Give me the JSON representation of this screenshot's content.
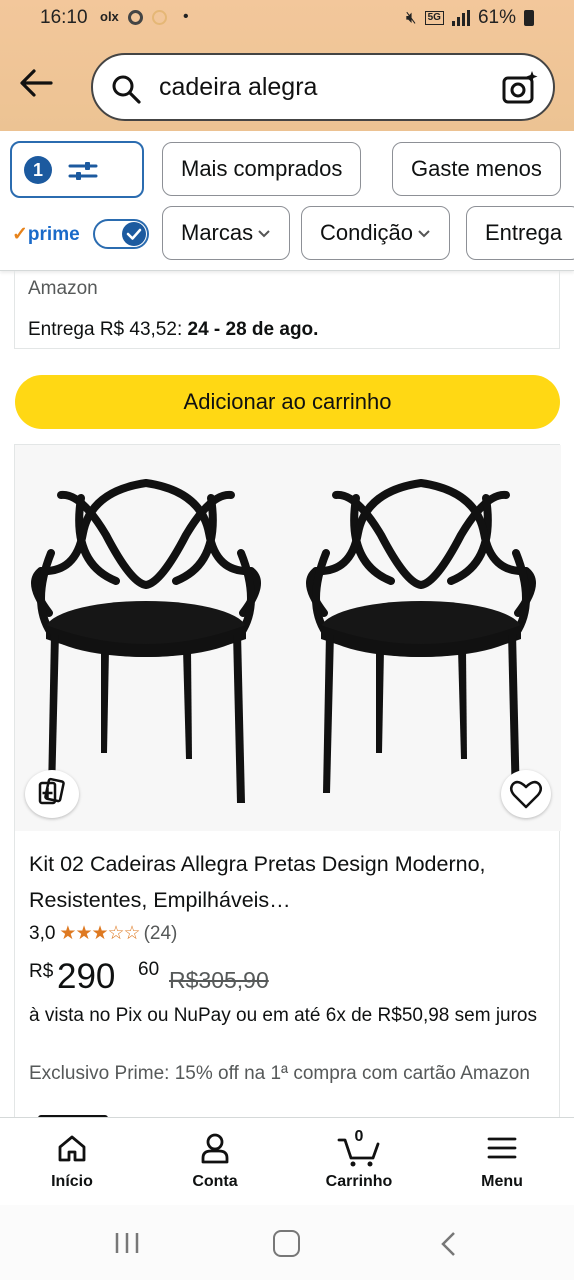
{
  "status_bar": {
    "time": "16:10",
    "olx": "olx",
    "battery": "61%",
    "network": "5G"
  },
  "search": {
    "value": "cadeira alegra"
  },
  "filters": {
    "count": "1",
    "chips_row1": [
      "Mais comprados",
      "Gaste menos"
    ],
    "chips_row2": [
      "Marcas",
      "Condição",
      "Entrega"
    ],
    "prime_label": "prime",
    "prime_toggle_on": true
  },
  "previous_result": {
    "seller": "Amazon",
    "delivery_prefix": "Entrega R$ 43,52: ",
    "delivery_dates": "24 - 28 de ago.",
    "add_to_cart": "Adicionar ao carrinho"
  },
  "product": {
    "title": "Kit 02 Cadeiras Allegra Pretas Design Moderno, Resistentes, Empilháveis…",
    "rating_value": "3,0",
    "rating_stars": 3,
    "stars_text": "★★★☆☆",
    "review_count": "(24)",
    "price_currency": "R$",
    "price_integer": "290",
    "price_cents": "60",
    "price_old": "R$305,90",
    "payment_info": "à vista no Pix ou NuPay ou em até 6x de R$50,98 sem juros",
    "exclusive_prime": "Exclusivo Prime: 15% off na 1ª compra com cartão Amazon"
  },
  "bottom_nav": {
    "items": [
      {
        "label": "Início",
        "icon": "home-icon"
      },
      {
        "label": "Conta",
        "icon": "user-icon"
      },
      {
        "label": "Carrinho",
        "icon": "cart-icon"
      },
      {
        "label": "Menu",
        "icon": "menu-icon"
      }
    ],
    "cart_count": "0"
  },
  "colors": {
    "header_bg": "#f0c597",
    "add_to_cart": "#ffd814",
    "filter_accent": "#1c5a9f",
    "star": "#de7921"
  }
}
